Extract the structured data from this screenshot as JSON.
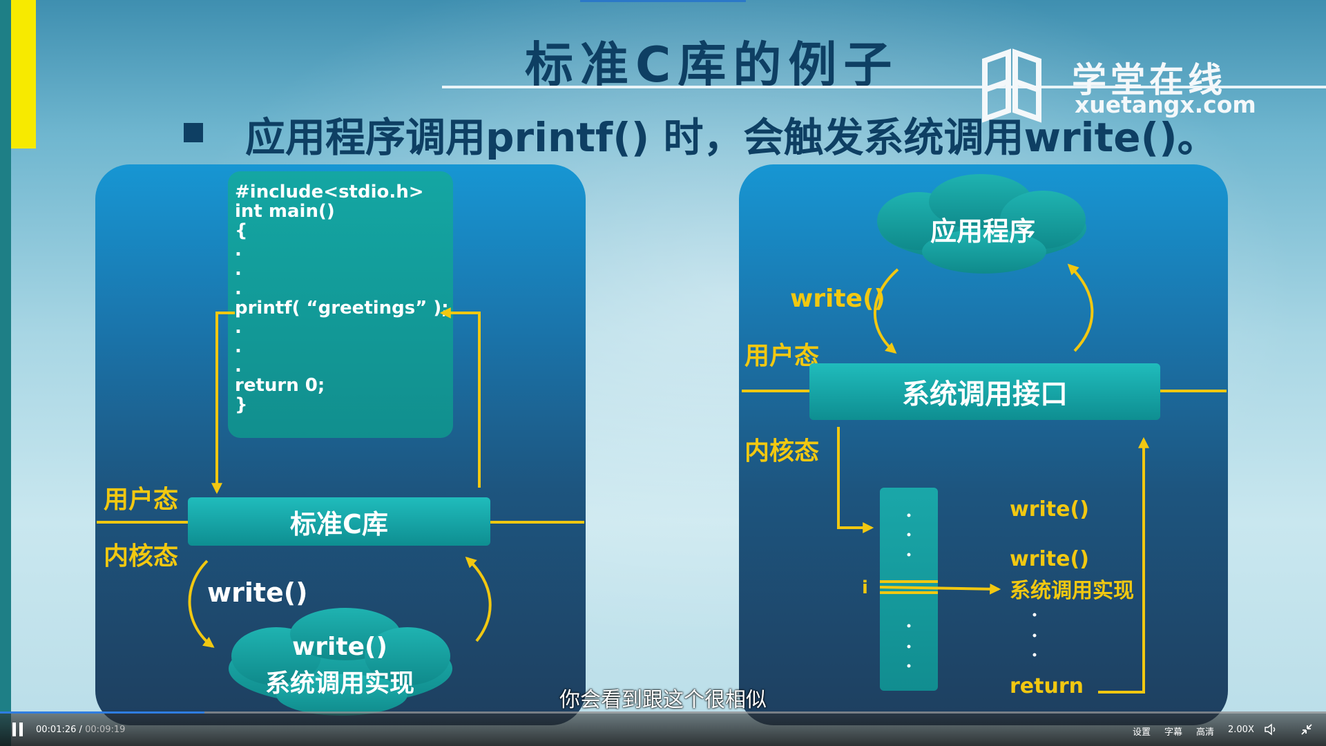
{
  "slide": {
    "title": "标准C库的例子",
    "bullet": "应用程序调用printf() 时，会触发系统调用write()。",
    "logo_cn": "学堂在线",
    "logo_en": "xuetangx.com"
  },
  "left_diagram": {
    "code_lines": "#include<stdio.h>\nint main()\n{\n.\n.\n.\nprintf( “greetings” );\n.\n.\n.\nreturn 0;\n}",
    "user_mode": "用户态",
    "kernel_mode": "内核态",
    "lib_box": "标准C库",
    "write_call": "write()",
    "impl_top": "write()",
    "impl_bottom": "系统调用实现"
  },
  "right_diagram": {
    "app_cloud": "应用程序",
    "write_call": "write()",
    "user_mode": "用户态",
    "kernel_mode": "内核态",
    "interface_box": "系统调用接口",
    "index_label": "i",
    "list_write": "write()",
    "list_impl_top": "write()",
    "list_impl_bottom": "系统调用实现",
    "list_return": "return"
  },
  "player": {
    "current_time": "00:01:26",
    "separator": "/",
    "total_time": "00:09:19",
    "progress": 0.154,
    "subtitle": "你会看到跟这个很相似",
    "settings": "设置",
    "captions": "字幕",
    "quality": "高清",
    "speed": "2.00X",
    "volume_icon": "speaker-icon",
    "exit_fullscreen_icon": "exit-fullscreen-icon"
  },
  "colors": {
    "title": "#0e3f63",
    "accent_yellow": "#f2c811",
    "teal_box": "#14a6a3",
    "progress": "#2f7de1"
  }
}
